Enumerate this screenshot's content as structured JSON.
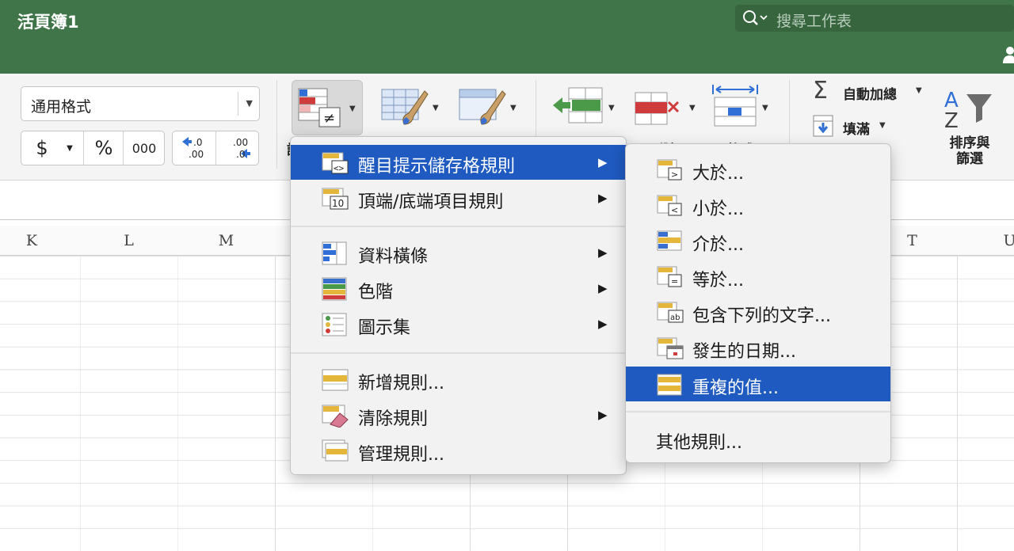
{
  "window": {
    "title": "活頁簿1",
    "search_placeholder": "搜尋工作表"
  },
  "ribbon": {
    "number_format": "通用格式",
    "currency": "$",
    "percent": "%",
    "comma": "000",
    "inc_decimal_top": ".0",
    "inc_decimal_bottom": ".00",
    "dec_decimal_top": ".00",
    "dec_decimal_bottom": ".0",
    "autosum": "自動加總",
    "fill": "填滿",
    "sort_filter_line1": "排序與",
    "sort_filter_line2": "篩選",
    "cf_label_fragment": "設",
    "delete_label_fragment": "刪除",
    "format_label_fragment": "格式",
    "sort_az_top": "A",
    "sort_az_bottom": "Z"
  },
  "columns": [
    "K",
    "L",
    "M",
    "T",
    "U"
  ],
  "cf_menu": {
    "items": [
      {
        "label": "醒目提示儲存格規則",
        "submenu": true,
        "highlighted": true
      },
      {
        "label": "頂端/底端項目規則",
        "submenu": true,
        "icon_text": "10"
      },
      {
        "label": "資料橫條",
        "submenu": true
      },
      {
        "label": "色階",
        "submenu": true
      },
      {
        "label": "圖示集",
        "submenu": true
      },
      {
        "label": "新增規則...",
        "submenu": false
      },
      {
        "label": "清除規則",
        "submenu": true
      },
      {
        "label": "管理規則...",
        "submenu": false
      }
    ],
    "highlight_icon_text": "<>"
  },
  "highlight_submenu": {
    "items": [
      {
        "label": "大於...",
        "icon_text": ">"
      },
      {
        "label": "小於...",
        "icon_text": "<"
      },
      {
        "label": "介於..."
      },
      {
        "label": "等於...",
        "icon_text": "="
      },
      {
        "label": "包含下列的文字...",
        "icon_text": "ab"
      },
      {
        "label": "發生的日期..."
      },
      {
        "label": "重複的值...",
        "highlighted": true
      },
      {
        "label": "其他規則..."
      }
    ]
  },
  "colors": {
    "titlebar": "#3f7548",
    "highlight": "#1f5ac1",
    "menu_bg": "#f2f2f2",
    "accent_blue": "#2f6fd6",
    "accent_green": "#4a9a4a",
    "accent_red": "#d03b3b"
  }
}
